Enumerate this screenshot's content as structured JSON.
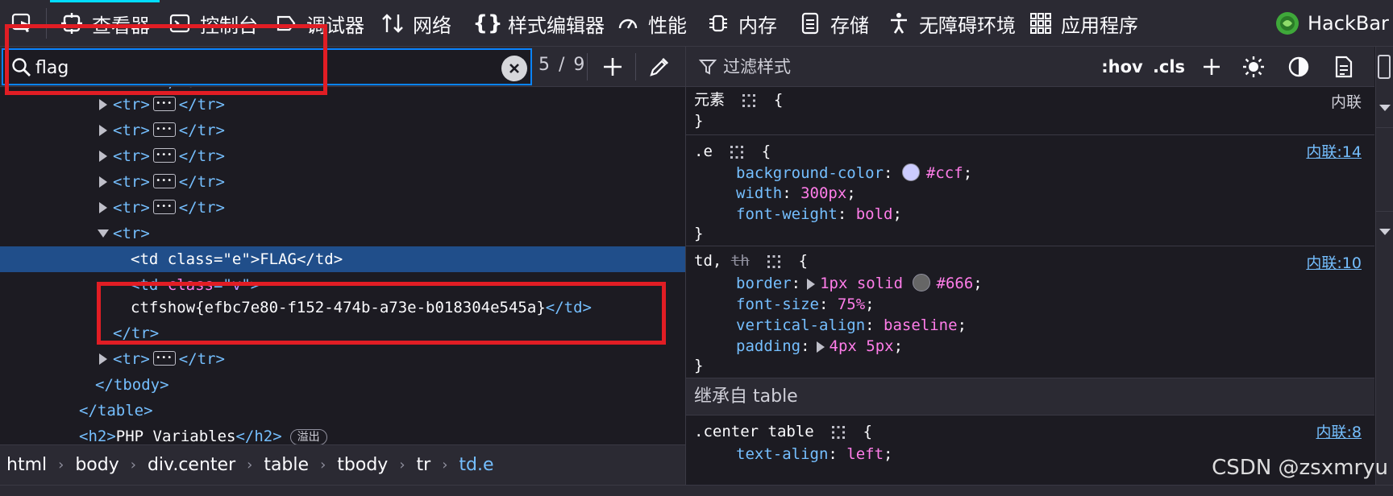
{
  "tabs": [
    {
      "label": "查看器",
      "icon": "inspector-icon",
      "active": true
    },
    {
      "label": "控制台",
      "icon": "console-icon"
    },
    {
      "label": "调试器",
      "icon": "debugger-icon"
    },
    {
      "label": "网络",
      "icon": "network-icon"
    },
    {
      "label": "样式编辑器",
      "icon": "style-editor-icon"
    },
    {
      "label": "性能",
      "icon": "performance-icon"
    },
    {
      "label": "内存",
      "icon": "memory-icon"
    },
    {
      "label": "存储",
      "icon": "storage-icon"
    },
    {
      "label": "无障碍环境",
      "icon": "accessibility-icon"
    },
    {
      "label": "应用程序",
      "icon": "application-icon"
    },
    {
      "label": "HackBar",
      "icon": "hackbar-icon"
    }
  ],
  "search": {
    "value": "flag",
    "match_count": "5 / 9"
  },
  "markup": {
    "partial_top": "<tr> </td>",
    "tr": "<tr>",
    "tr_close": "</tr>",
    "td_open": "<td ",
    "class_attr": "class",
    "eq": "=\"",
    "e_val": "e",
    "close_gt": "\">",
    "flag_text": "FLAG",
    "td_close": "</td>",
    "v_val": "v",
    "ctf_text": "ctfshow{efbc7e80-f152-474b-a73e-b018304e545a}",
    "tbody_close": "</tbody>",
    "table_close": "</table>",
    "h2_open": "<h2>",
    "h2_text": "PHP Variables",
    "h2_close": "</h2>",
    "export_badge": "溢出"
  },
  "breadcrumb": [
    "html",
    "body",
    "div.center",
    "table",
    "tbody",
    "tr",
    "td.e"
  ],
  "rules_toolbar": {
    "filter_placeholder": "过滤样式",
    "hov": ":hov",
    "cls": ".cls"
  },
  "rules": {
    "element": {
      "selector": "元素",
      "source": "内联",
      "open": "{",
      "close": "}"
    },
    "e_rule": {
      "selector": ".e",
      "source": "内联:14",
      "decls": [
        {
          "prop": "background-color",
          "value": "#ccf",
          "swatch": "#ccccff"
        },
        {
          "prop": "width",
          "value": "300px"
        },
        {
          "prop": "font-weight",
          "value": "bold"
        }
      ]
    },
    "td_rule": {
      "selector_a": "td, ",
      "selector_b": "th",
      "source": "内联:10",
      "decls": [
        {
          "prop": "border",
          "value_a": "1px solid",
          "value_b": "#666",
          "swatch": "#666666"
        },
        {
          "prop": "font-size",
          "value": "75%"
        },
        {
          "prop": "vertical-align",
          "value": "baseline"
        },
        {
          "prop": "padding",
          "value": "4px 5px"
        }
      ]
    },
    "inherited_header": "继承自 table",
    "center_rule": {
      "selector": ".center table",
      "source": "内联:8",
      "partial_decl_prop": "text-align",
      "partial_decl_value": "left"
    }
  },
  "watermark": "CSDN @zsxmryu"
}
